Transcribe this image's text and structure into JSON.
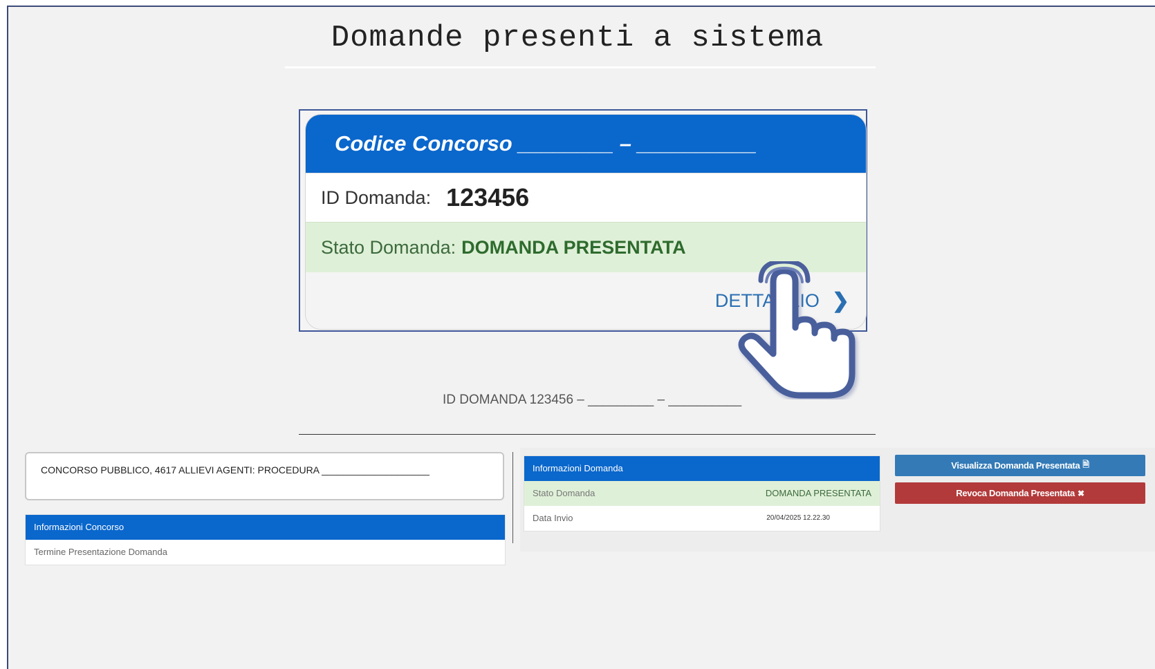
{
  "page": {
    "title": "Domande presenti a sistema"
  },
  "card": {
    "header": "Codice Concorso ________ – __________",
    "id_label": "ID Domanda:",
    "id_value": "123456",
    "status_label": "Stato Domanda:",
    "status_value": "DOMANDA PRESENTATA",
    "detail_link": "DETTAGLIO"
  },
  "id_line": "ID DOMANDA 123456 – _________ – __________",
  "concorso": {
    "title": "CONCORSO PUBBLICO, 4617 ALLIEVI AGENTI: PROCEDURA ____________________"
  },
  "info_concorso": {
    "header": "Informazioni Concorso",
    "rows": [
      {
        "label": "Termine Presentazione Domanda",
        "value": ""
      }
    ]
  },
  "info_domanda": {
    "header": "Informazioni Domanda",
    "status_label": "Stato Domanda",
    "status_value": "DOMANDA PRESENTATA",
    "date_label": "Data Invio",
    "date_value": "20/04/2025 12.22.30"
  },
  "buttons": {
    "view": "Visualizza Domanda Presentata",
    "revoke": "Revoca Domanda Presentata"
  },
  "icons": {
    "pointer": "hand-pointer-icon",
    "chevron": "chevron-right-icon",
    "view": "document-icon",
    "revoke": "close-circle-icon"
  },
  "colors": {
    "primary": "#0a67cc",
    "success_bg": "#dff0d8",
    "btn_blue": "#337ab7",
    "btn_red": "#b33a3a"
  }
}
